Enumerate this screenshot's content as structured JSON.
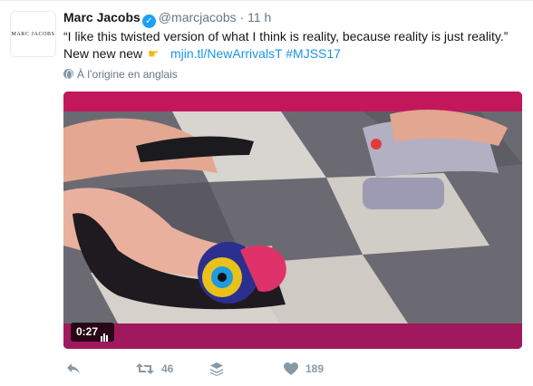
{
  "tweet": {
    "avatar_text": "MARC JACOBS",
    "author_name": "Marc Jacobs",
    "handle": "@marcjacobs",
    "separator": "·",
    "time": "11 h",
    "text_line1": "“I like this twisted version of what I think is reality, because reality is just reality.”",
    "text_line2": "New new new",
    "link": "mjin.tl/NewArrivalsT",
    "hashtag": "#MJSS17",
    "translation_note": "À l’origine en anglais",
    "video_duration": "0:27",
    "retweet_count": "46",
    "like_count": "189"
  },
  "icons": {
    "verified": "verified-badge-icon",
    "emoji": "pointing-hand-emoji",
    "globe": "globe-icon",
    "reply": "reply-icon",
    "retweet": "retweet-icon",
    "stack": "moments-stack-icon",
    "like": "heart-icon",
    "volume": "audio-bars-icon"
  },
  "colors": {
    "link": "#1b95e0",
    "verified": "#1da1f2",
    "action_icon": "#8899a6",
    "muted_text": "#657786"
  }
}
